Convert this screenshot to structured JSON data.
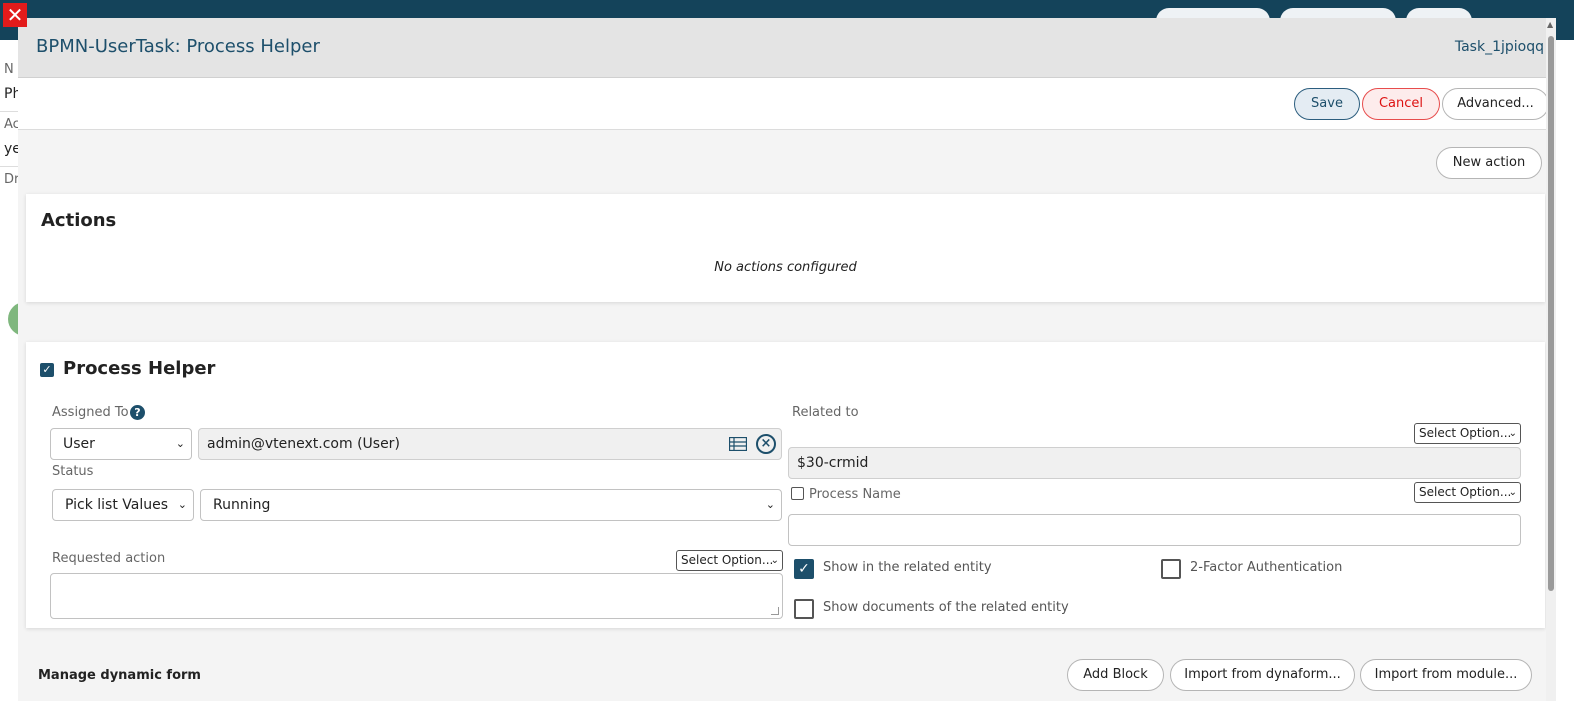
{
  "modal": {
    "close_glyph": "✕",
    "title": "BPMN-UserTask: Process Helper",
    "task_id": "Task_1jpioqq"
  },
  "toolbar": {
    "save_label": "Save",
    "cancel_label": "Cancel",
    "advanced_label": "Advanced..."
  },
  "actions_section": {
    "new_action_label": "New action",
    "title": "Actions",
    "empty_message": "No actions configured"
  },
  "process_helper": {
    "enabled": true,
    "title": "Process Helper",
    "assigned_to": {
      "label": "Assigned To",
      "type_value": "User",
      "value": "admin@vtenext.com (User)"
    },
    "related_to": {
      "label": "Related to",
      "select_option": "Select Option...",
      "value": "$30-crmid"
    },
    "status": {
      "label": "Status",
      "source_value": "Pick list Values",
      "value": "Running"
    },
    "process_name": {
      "label": "Process Name",
      "checked": false,
      "select_option": "Select Option...",
      "value": ""
    },
    "requested_action": {
      "label": "Requested action",
      "select_option": "Select Option...",
      "value": ""
    },
    "show_in_related": {
      "label": "Show in the related entity",
      "checked": true
    },
    "two_factor": {
      "label": "2-Factor Authentication",
      "checked": false
    },
    "show_documents": {
      "label": "Show documents of the related entity",
      "checked": false
    }
  },
  "dynamic_form": {
    "title": "Manage dynamic form",
    "add_block_label": "Add Block",
    "import_dynaform_label": "Import from dynaform...",
    "import_module_label": "Import from module..."
  },
  "background": {
    "fragments": [
      "N",
      "Ph",
      "Ac",
      "ye",
      "Dr"
    ]
  },
  "colors": {
    "accent": "#1d4f6b",
    "cancel": "#d11111",
    "topbar": "#14435a"
  }
}
